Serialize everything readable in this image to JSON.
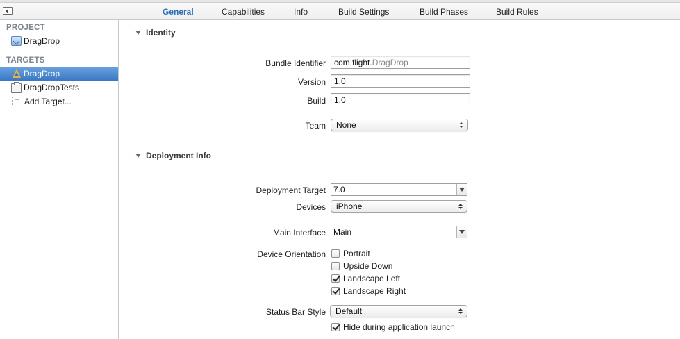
{
  "tabs": [
    {
      "label": "General",
      "active": true
    },
    {
      "label": "Capabilities",
      "active": false
    },
    {
      "label": "Info",
      "active": false
    },
    {
      "label": "Build Settings",
      "active": false
    },
    {
      "label": "Build Phases",
      "active": false
    },
    {
      "label": "Build Rules",
      "active": false
    }
  ],
  "sidebar": {
    "project_header": "PROJECT",
    "project_item": "DragDrop",
    "targets_header": "TARGETS",
    "targets": [
      {
        "label": "DragDrop",
        "selected": true
      },
      {
        "label": "DragDropTests",
        "selected": false
      }
    ],
    "add_target": "Add Target..."
  },
  "identity": {
    "title": "Identity",
    "bundle_identifier_label": "Bundle Identifier",
    "bundle_identifier_prefix": "com.flight.",
    "bundle_identifier_suffix": "DragDrop",
    "version_label": "Version",
    "version_value": "1.0",
    "build_label": "Build",
    "build_value": "1.0",
    "team_label": "Team",
    "team_value": "None"
  },
  "deployment": {
    "title": "Deployment Info",
    "target_label": "Deployment Target",
    "target_value": "7.0",
    "devices_label": "Devices",
    "devices_value": "iPhone",
    "main_interface_label": "Main Interface",
    "main_interface_value": "Main",
    "orientation_label": "Device Orientation",
    "orientations": [
      {
        "label": "Portrait",
        "checked": false
      },
      {
        "label": "Upside Down",
        "checked": false
      },
      {
        "label": "Landscape Left",
        "checked": true
      },
      {
        "label": "Landscape Right",
        "checked": true
      }
    ],
    "status_bar_label": "Status Bar Style",
    "status_bar_value": "Default",
    "hide_status_label": "Hide during application launch",
    "hide_status_checked": true
  },
  "colors": {
    "active_tab": "#2f6fb4",
    "selection": "#3a78c4"
  }
}
